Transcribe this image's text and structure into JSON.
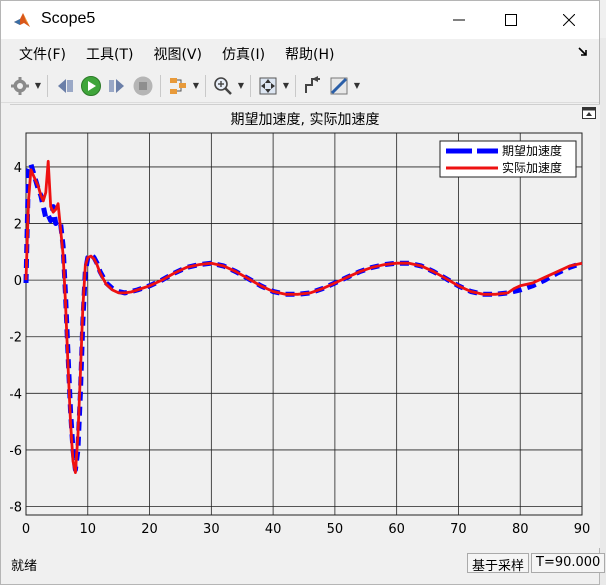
{
  "window": {
    "title": "Scope5"
  },
  "menu": {
    "items": [
      "文件(F)",
      "工具(T)",
      "视图(V)",
      "仿真(I)",
      "帮助(H)"
    ]
  },
  "toolbar": {
    "buttons": [
      "settings-icon",
      "step-back-icon",
      "run-icon",
      "step-forward-icon",
      "stop-icon",
      "highlight-icon",
      "zoom-icon",
      "autoscale-icon",
      "cursor-icon",
      "measure-icon"
    ]
  },
  "status": {
    "left": "就绪",
    "mode": "基于采样",
    "time": "T=90.000"
  },
  "colors": {
    "desired": "#0000ff",
    "actual": "#ee1111",
    "plot_bg": "#f0f0f0",
    "grid": "#222222"
  },
  "chart_data": {
    "type": "line",
    "title": "期望加速度, 实际加速度",
    "xlabel": "",
    "ylabel": "",
    "xlim": [
      0,
      90
    ],
    "ylim": [
      -8.3,
      5.2
    ],
    "xticks": [
      0,
      10,
      20,
      30,
      40,
      50,
      60,
      70,
      80,
      90
    ],
    "yticks": [
      -8,
      -6,
      -4,
      -2,
      0,
      2,
      4
    ],
    "grid": true,
    "legend_position": "top-right",
    "series": [
      {
        "name": "期望加速度",
        "style": "dashed",
        "x": [
          0,
          0.4,
          0.8,
          1.2,
          1.6,
          2.0,
          2.4,
          2.8,
          3.2,
          3.6,
          4.0,
          4.4,
          4.8,
          5.2,
          5.6,
          6.0,
          6.4,
          6.8,
          7.2,
          7.6,
          8.0,
          8.4,
          8.8,
          9.2,
          9.6,
          10.0,
          10.5,
          11.0,
          11.5,
          12,
          13,
          14,
          15,
          16,
          17,
          18,
          20,
          22,
          24,
          26,
          28,
          30,
          32,
          34,
          36,
          38,
          40,
          42,
          44,
          46,
          48,
          50,
          52,
          54,
          56,
          58,
          60,
          62,
          64,
          66,
          68,
          70,
          72,
          74,
          76,
          78,
          80,
          82,
          84,
          86,
          88,
          90
        ],
        "y": [
          -0.1,
          3.9,
          4.1,
          3.8,
          3.5,
          3.2,
          3.0,
          2.6,
          2.2,
          2.3,
          2.1,
          2.6,
          2.0,
          2.1,
          2.0,
          1.2,
          -0.5,
          -2.6,
          -4.6,
          -6.0,
          -6.7,
          -6.0,
          -4.0,
          -1.5,
          0.3,
          0.8,
          0.9,
          0.8,
          0.6,
          0.3,
          -0.1,
          -0.3,
          -0.4,
          -0.45,
          -0.4,
          -0.35,
          -0.2,
          0.0,
          0.25,
          0.45,
          0.55,
          0.6,
          0.5,
          0.3,
          0.05,
          -0.2,
          -0.4,
          -0.5,
          -0.5,
          -0.45,
          -0.3,
          -0.1,
          0.1,
          0.3,
          0.45,
          0.55,
          0.6,
          0.6,
          0.5,
          0.3,
          0.05,
          -0.2,
          -0.4,
          -0.5,
          -0.5,
          -0.45,
          -0.35,
          -0.2,
          0.0,
          0.25,
          0.45,
          0.6
        ]
      },
      {
        "name": "实际加速度",
        "style": "solid",
        "x": [
          0,
          0.4,
          0.8,
          1.2,
          1.6,
          2.0,
          2.4,
          2.8,
          3.2,
          3.6,
          4.0,
          4.4,
          4.8,
          5.2,
          5.6,
          6.0,
          6.4,
          6.8,
          7.2,
          7.6,
          8.0,
          8.4,
          8.8,
          9.2,
          9.6,
          10.0,
          10.5,
          11.0,
          11.5,
          12,
          13,
          14,
          15,
          16,
          17,
          18,
          20,
          22,
          24,
          26,
          28,
          30,
          32,
          34,
          36,
          38,
          40,
          42,
          44,
          46,
          48,
          50,
          52,
          54,
          56,
          58,
          60,
          62,
          64,
          66,
          68,
          70,
          72,
          74,
          76,
          78,
          79,
          80,
          82,
          84,
          86,
          88,
          90
        ],
        "y": [
          0.0,
          2.8,
          3.9,
          3.7,
          3.5,
          3.3,
          3.0,
          2.8,
          3.1,
          4.2,
          2.6,
          2.4,
          2.5,
          2.7,
          1.8,
          0.9,
          -0.8,
          -3.0,
          -5.0,
          -6.4,
          -6.8,
          -5.5,
          -3.3,
          -1.0,
          0.5,
          0.8,
          0.85,
          0.75,
          0.55,
          0.25,
          -0.15,
          -0.35,
          -0.45,
          -0.45,
          -0.42,
          -0.35,
          -0.2,
          0.0,
          0.25,
          0.45,
          0.55,
          0.6,
          0.5,
          0.3,
          0.05,
          -0.2,
          -0.4,
          -0.5,
          -0.5,
          -0.45,
          -0.3,
          -0.1,
          0.1,
          0.3,
          0.45,
          0.55,
          0.6,
          0.6,
          0.5,
          0.3,
          0.05,
          -0.2,
          -0.4,
          -0.5,
          -0.5,
          -0.45,
          -0.3,
          -0.2,
          -0.1,
          0.1,
          0.3,
          0.5,
          0.6
        ]
      }
    ]
  }
}
